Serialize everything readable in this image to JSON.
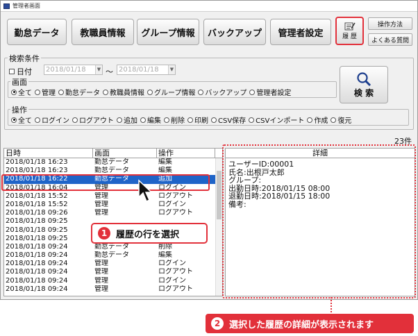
{
  "window": {
    "title": "管理者画面"
  },
  "nav": {
    "attendance": "勤怠データ",
    "staff": "教職員情報",
    "group": "グループ情報",
    "backup": "バックアップ",
    "admin": "管理者設定",
    "history": "履 歴",
    "howto": "操作方法",
    "faq": "よくある質問"
  },
  "search": {
    "group_title": "検索条件",
    "date_label": "日付",
    "date_from": "2018/01/18",
    "date_to": "2018/01/18",
    "tilde": "～",
    "screen_title": "画面",
    "screen_options": [
      "全て",
      "管理",
      "勤怠データ",
      "教職員情報",
      "グループ情報",
      "バックアップ",
      "管理者設定"
    ],
    "op_title": "操作",
    "op_options": [
      "全て",
      "ログイン",
      "ログアウト",
      "追加",
      "編集",
      "削除",
      "印刷",
      "CSV保存",
      "CSVインポート",
      "作成",
      "復元"
    ],
    "search_button": "検 索"
  },
  "count": "23件",
  "table": {
    "headers": [
      "日時",
      "画面",
      "操作"
    ],
    "rows": [
      [
        "2018/01/18 16:23",
        "勤怠データ",
        "編集"
      ],
      [
        "2018/01/18 16:23",
        "勤怠データ",
        "編集"
      ],
      [
        "2018/01/18 16:22",
        "勤怠データ",
        "追加"
      ],
      [
        "2018/01/18 16:04",
        "管理",
        "ログイン"
      ],
      [
        "2018/01/18 15:52",
        "管理",
        "ログアウト"
      ],
      [
        "2018/01/18 15:52",
        "管理",
        "ログイン"
      ],
      [
        "2018/01/18 09:26",
        "管理",
        "ログアウト"
      ],
      [
        "2018/01/18 09:25",
        "",
        ""
      ],
      [
        "2018/01/18 09:25",
        "",
        ""
      ],
      [
        "2018/01/18 09:25",
        "",
        ""
      ],
      [
        "2018/01/18 09:24",
        "勤怠データ",
        "削除"
      ],
      [
        "2018/01/18 09:24",
        "勤怠データ",
        "編集"
      ],
      [
        "2018/01/18 09:24",
        "管理",
        "ログイン"
      ],
      [
        "2018/01/18 09:24",
        "管理",
        "ログアウト"
      ],
      [
        "2018/01/18 09:24",
        "管理",
        "ログイン"
      ],
      [
        "2018/01/18 09:24",
        "管理",
        "ログアウト"
      ]
    ]
  },
  "detail": {
    "title": "詳細",
    "lines": [
      "ユーザーID:00001",
      "氏名:出根戸太郎",
      "グループ:",
      "出勤日時:2018/01/15 08:00",
      "退勤日時:2018/01/15 18:00",
      "備考:"
    ]
  },
  "callouts": {
    "step1_num": "1",
    "step1": "履歴の行を選択",
    "step2_num": "2",
    "step2": "選択した履歴の詳細が表示されます"
  },
  "colors": {
    "accent": "#e2303a",
    "selection": "#1f64c8"
  }
}
